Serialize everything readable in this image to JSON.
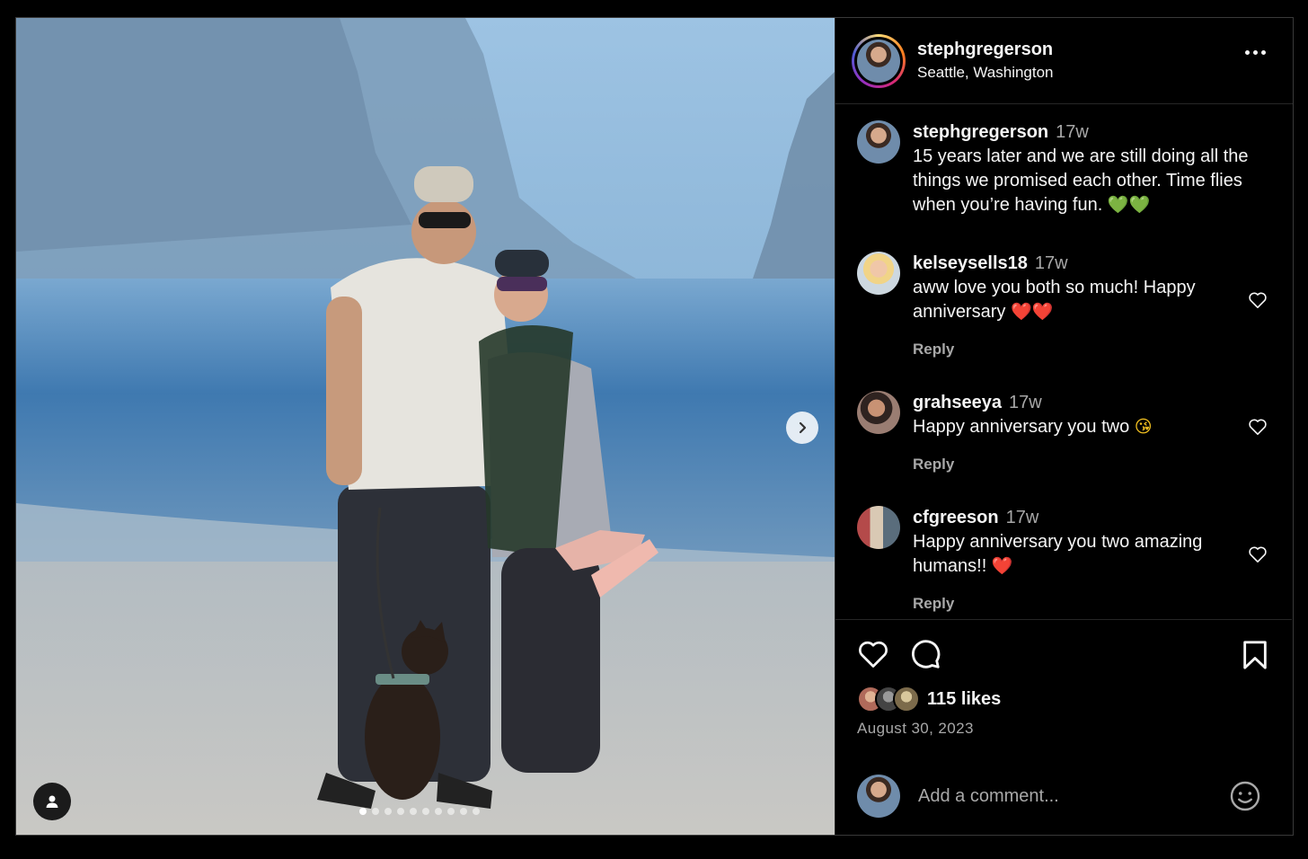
{
  "post": {
    "username": "stephgregerson",
    "location": "Seattle, Washington",
    "photo_count": 10,
    "active_photo": 1
  },
  "comments": [
    {
      "username": "stephgregerson",
      "time": "17w",
      "text": "15 years later and we are still doing all the things we promised each other. Time flies when you’re having fun.",
      "emoji": "💚💚",
      "is_caption": true
    },
    {
      "username": "kelseysells18",
      "time": "17w",
      "text": "aww love you both so much! Happy anniversary",
      "emoji": "❤️❤️",
      "reply": "Reply"
    },
    {
      "username": "grahseeya",
      "time": "17w",
      "text": "Happy anniversary you two",
      "emoji": "😘",
      "reply": "Reply"
    },
    {
      "username": "cfgreeson",
      "time": "17w",
      "text": "Happy anniversary you two amazing humans!!",
      "emoji": "❤️",
      "reply": "Reply"
    }
  ],
  "engagement": {
    "likes": "115 likes",
    "date": "August 30, 2023"
  },
  "composer": {
    "placeholder": "Add a comment..."
  },
  "icons": {
    "more": "more-options-icon",
    "next": "chevron-right-icon",
    "tag": "user-tag-icon",
    "like": "heart-icon",
    "comment": "comment-bubble-icon",
    "save": "bookmark-icon",
    "emoji": "smiley-icon"
  },
  "colors": {
    "background": "#000000",
    "text": "#f5f5f5",
    "secondary_text": "#a8a8a8",
    "divider": "#262626"
  }
}
